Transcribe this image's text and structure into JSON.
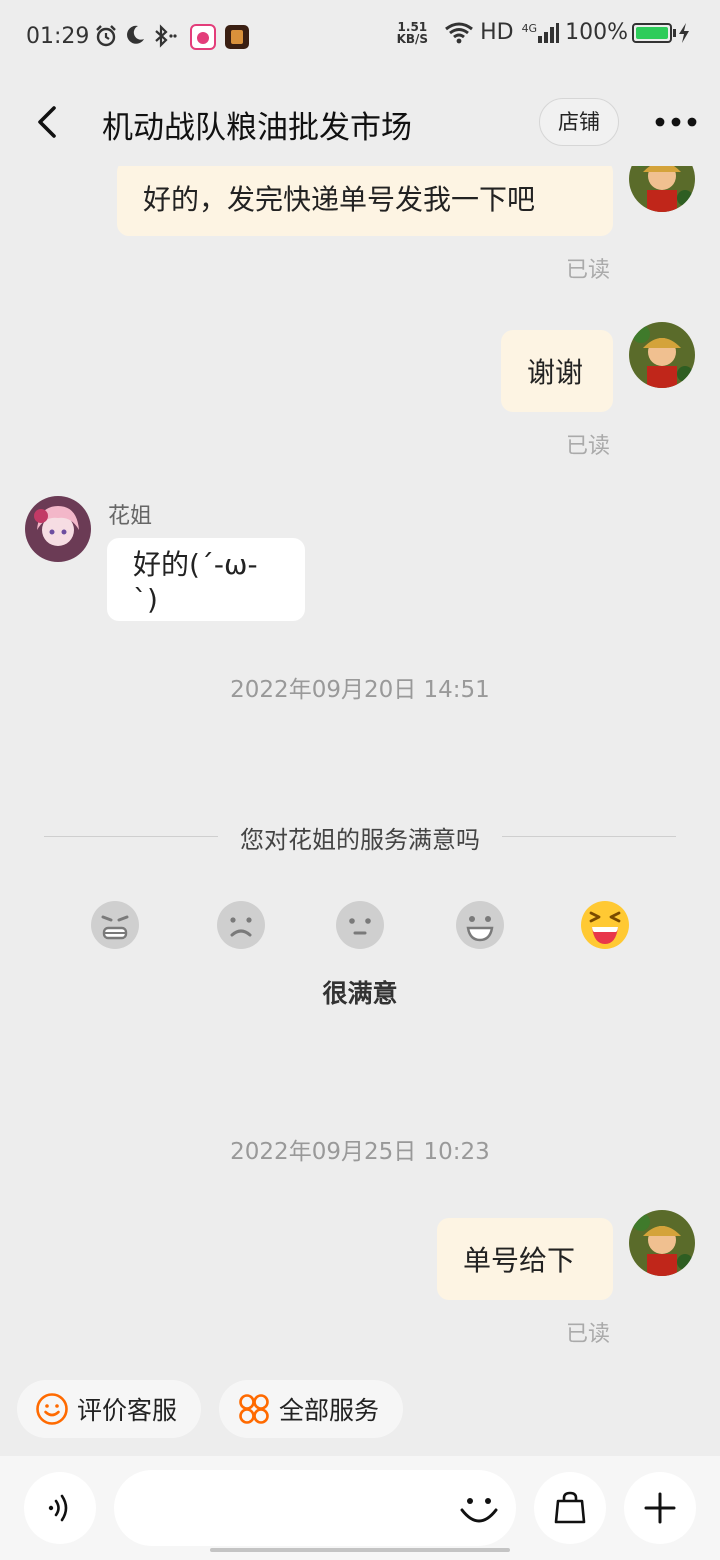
{
  "status_bar": {
    "time": "01:29",
    "net_speed_value": "1.51",
    "net_speed_unit": "KB/S",
    "hd": "HD",
    "network": "4G",
    "battery": "100%",
    "icons": [
      "alarm-icon",
      "moon-icon",
      "bluetooth-icon",
      "app-icon-music",
      "app-icon-game",
      "wifi-icon",
      "signal-icon",
      "battery-icon",
      "charging-icon"
    ]
  },
  "nav": {
    "title": "机动战队粮油批发市场",
    "shop_label": "店铺"
  },
  "messages": [
    {
      "side": "me",
      "text": "好的，发完快递单号发我一下吧",
      "status": "已读"
    },
    {
      "side": "me",
      "text": "谢谢",
      "status": "已读"
    },
    {
      "side": "other",
      "sender": "花姐",
      "text": "好的(´-ω-`)"
    },
    {
      "type": "timestamp",
      "text": "2022年09月20日 14:51"
    },
    {
      "type": "timestamp",
      "text": "2022年09月25日 10:23"
    },
    {
      "side": "me",
      "text": "单号给下",
      "status": "已读"
    }
  ],
  "satisfaction": {
    "title": "您对花姐的服务满意吗",
    "selected_label": "很满意",
    "faces": [
      "very-unsatisfied-face-icon",
      "unsatisfied-face-icon",
      "neutral-face-icon",
      "satisfied-face-icon",
      "very-satisfied-face-icon"
    ],
    "selected_index": 4
  },
  "quick_actions": {
    "rate_label": "评价客服",
    "all_services_label": "全部服务"
  },
  "input": {
    "placeholder": ""
  },
  "colors": {
    "my_bubble": "#fdf4e3",
    "other_bubble": "#ffffff",
    "background": "#ededed",
    "accent_orange": "#ff6a00",
    "selected_face": "#ffcc33"
  }
}
